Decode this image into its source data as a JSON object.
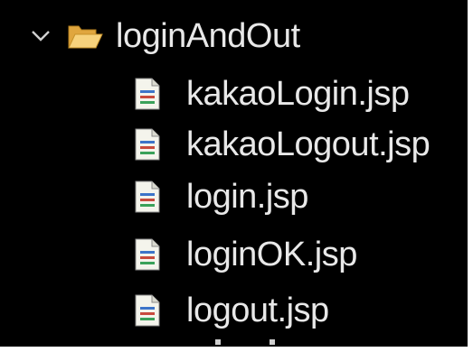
{
  "tree": {
    "folder": {
      "name": "loginAndOut",
      "expanded": true,
      "icon": "folder-open-icon",
      "toggle_icon": "chevron-down-icon"
    },
    "files": [
      {
        "name": "kakaoLogin.jsp",
        "icon": "jsp-file-icon"
      },
      {
        "name": "kakaoLogout.jsp",
        "icon": "jsp-file-icon"
      },
      {
        "name": "login.jsp",
        "icon": "jsp-file-icon"
      },
      {
        "name": "loginOK.jsp",
        "icon": "jsp-file-icon"
      },
      {
        "name": "logout.jsp",
        "icon": "jsp-file-icon"
      }
    ]
  },
  "colors": {
    "background": "#000000",
    "text": "#e8e8e8",
    "folder": "#f2c46a",
    "file_page": "#f4f4ec"
  }
}
